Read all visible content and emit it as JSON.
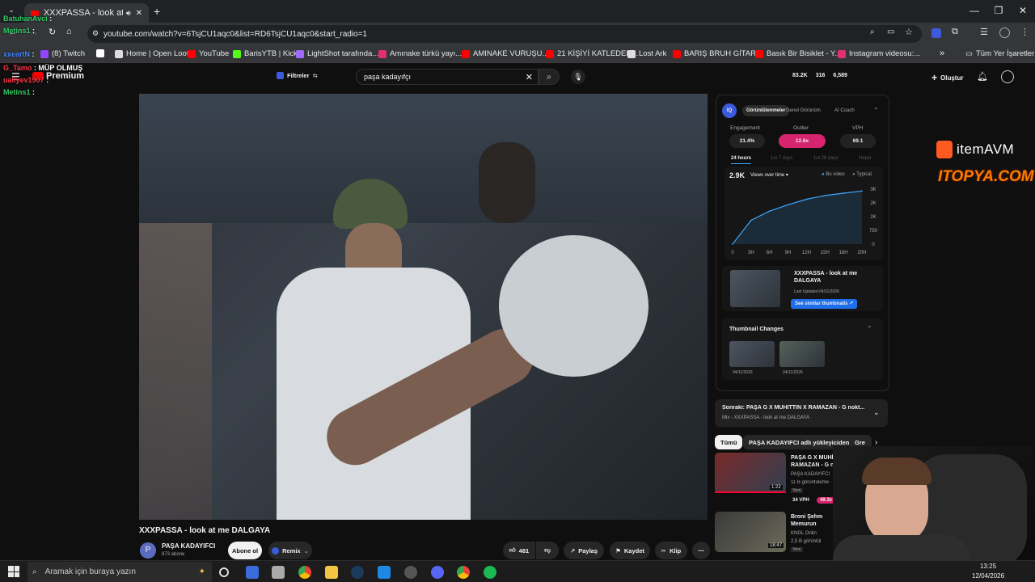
{
  "browser": {
    "tab_title": "XXXPASSA - look at me DA...",
    "url": "youtube.com/watch?v=6TsjCU1aqc0&list=RD6TsjCU1aqc0&start_radio=1",
    "all_bookmarks": "Tüm Yer İşaretleri",
    "bookmarks": [
      {
        "label": "(8) Twitch",
        "color": "#9146ff"
      },
      {
        "label": "",
        "color": "#ffffff"
      },
      {
        "label": "Home | Open Loot",
        "color": "#dddddd"
      },
      {
        "label": "YouTube",
        "color": "#ff0000"
      },
      {
        "label": "BarisYTB | Kick",
        "color": "#53fc18"
      },
      {
        "label": "LightShot tarafında...",
        "color": "#a06cff"
      },
      {
        "label": "Amınake türkü yayı...",
        "color": "#e1306c"
      },
      {
        "label": "AMINAKE VURUŞU...",
        "color": "#ff0000"
      },
      {
        "label": "21 KİŞİYİ KATLEDEN...",
        "color": "#ff0000"
      },
      {
        "label": "Lost Ark",
        "color": "#dddddd"
      },
      {
        "label": "BARIŞ BRUH GİTAR...",
        "color": "#ff0000"
      },
      {
        "label": "Basık Bir Bisiklet - Y...",
        "color": "#ff0000"
      },
      {
        "label": "Instagram videosu:...",
        "color": "#e1306c"
      }
    ]
  },
  "chat": [
    {
      "user": "BatuhanAvci",
      "text": ":",
      "color": "#33cc66"
    },
    {
      "user": "Metins1",
      "text": ":",
      "color": "#33cc66"
    },
    {
      "user": "xxeartN",
      "text": ":",
      "color": "#4488ff"
    },
    {
      "user": "G_Tamo",
      "text": ": MÜP OLMUŞ",
      "color": "#ff3344"
    },
    {
      "user": "ualiyev1907",
      "text": ":",
      "color": "#ff3344"
    },
    {
      "user": "Metins1",
      "text": ":",
      "color": "#33cc66"
    }
  ],
  "youtube": {
    "logo_text": "Premium",
    "filters_label": "Filtreler",
    "search_query": "paşa kadayıfçı",
    "stats_top": [
      "83.2K",
      "316",
      "6,589"
    ],
    "create_label": "Oluştur",
    "video_title": "XXXPASSA - look at me DALGAYA",
    "channel_name": "PAŞA KADAYIFCI",
    "subscribers": "873 abone",
    "subscribe_label": "Abone ol",
    "remix_label": "Remix",
    "likes": "481",
    "share_label": "Paylaş",
    "save_label": "Kaydet",
    "clip_label": "Klip"
  },
  "panel": {
    "tabs": [
      "Görüntülenmeler",
      "Genel Görünüm",
      "AI Coach"
    ],
    "stat_labels": [
      "Engagement",
      "Outlier",
      "VPH"
    ],
    "stat_values": [
      "21.4%",
      "12.6x",
      "69.1"
    ],
    "time_tabs": [
      "24 hours",
      "1st 7 days",
      "1st 28 days",
      "Hepsi"
    ],
    "views_value": "2.9K",
    "views_select": "Views over time",
    "legend_this": "Bu video",
    "legend_typical": "Typical",
    "thumb_title": "XXXPASSA - look at me DALGAYA",
    "last_updated": "Last Updated 04/11/2026",
    "similar_btn": "See similar thumbnails",
    "thumb_changes": "Thumbnail Changes",
    "thumb_dates": [
      "04/11/2026",
      "04/11/2026"
    ]
  },
  "chart_data": {
    "type": "line",
    "x": [
      "0",
      "3H",
      "6H",
      "9H",
      "12H",
      "15H",
      "18H",
      "20H"
    ],
    "y_ticks": [
      "3K",
      "2K",
      "2K",
      "750",
      "0"
    ],
    "series": [
      {
        "name": "Bu video",
        "values": [
          0,
          1300,
          1800,
          2150,
          2450,
          2650,
          2780,
          2900
        ]
      }
    ],
    "ylim": [
      0,
      3000
    ],
    "grid": false
  },
  "sidebar": {
    "next_title": "Sonraki: PAŞA G X MUHİTTİN X RAMAZAN - G nokt...",
    "next_sub": "Mix - XXXPASSA - look at me DALGAYA",
    "chips": [
      "Tümü",
      "PAŞA KADAYIFCI adlı yükleyiciden",
      "Gre"
    ],
    "videos": [
      {
        "title": "PAŞA G X MUHİTTİN X RAMAZAN - G noktanDAY",
        "channel": "PAŞA KADAYIFCI",
        "meta": "11 B görüntüleme · 3 gün",
        "badge": "Yeni",
        "duration": "1:22",
        "vph": "34 VPH",
        "outlier": "49.3x"
      },
      {
        "title": "Broni Şehm Memurun",
        "channel": "KNGL Onlin",
        "meta": "2,5 B görüntül",
        "badge": "Yeni",
        "duration": "18:47"
      }
    ]
  },
  "overlay": {
    "brand1": "itemAVM",
    "brand2": "ITOPYA.COM"
  },
  "taskbar": {
    "search_placeholder": "Aramak için buraya yazın",
    "time": "13:25",
    "date": "12/04/2026"
  }
}
